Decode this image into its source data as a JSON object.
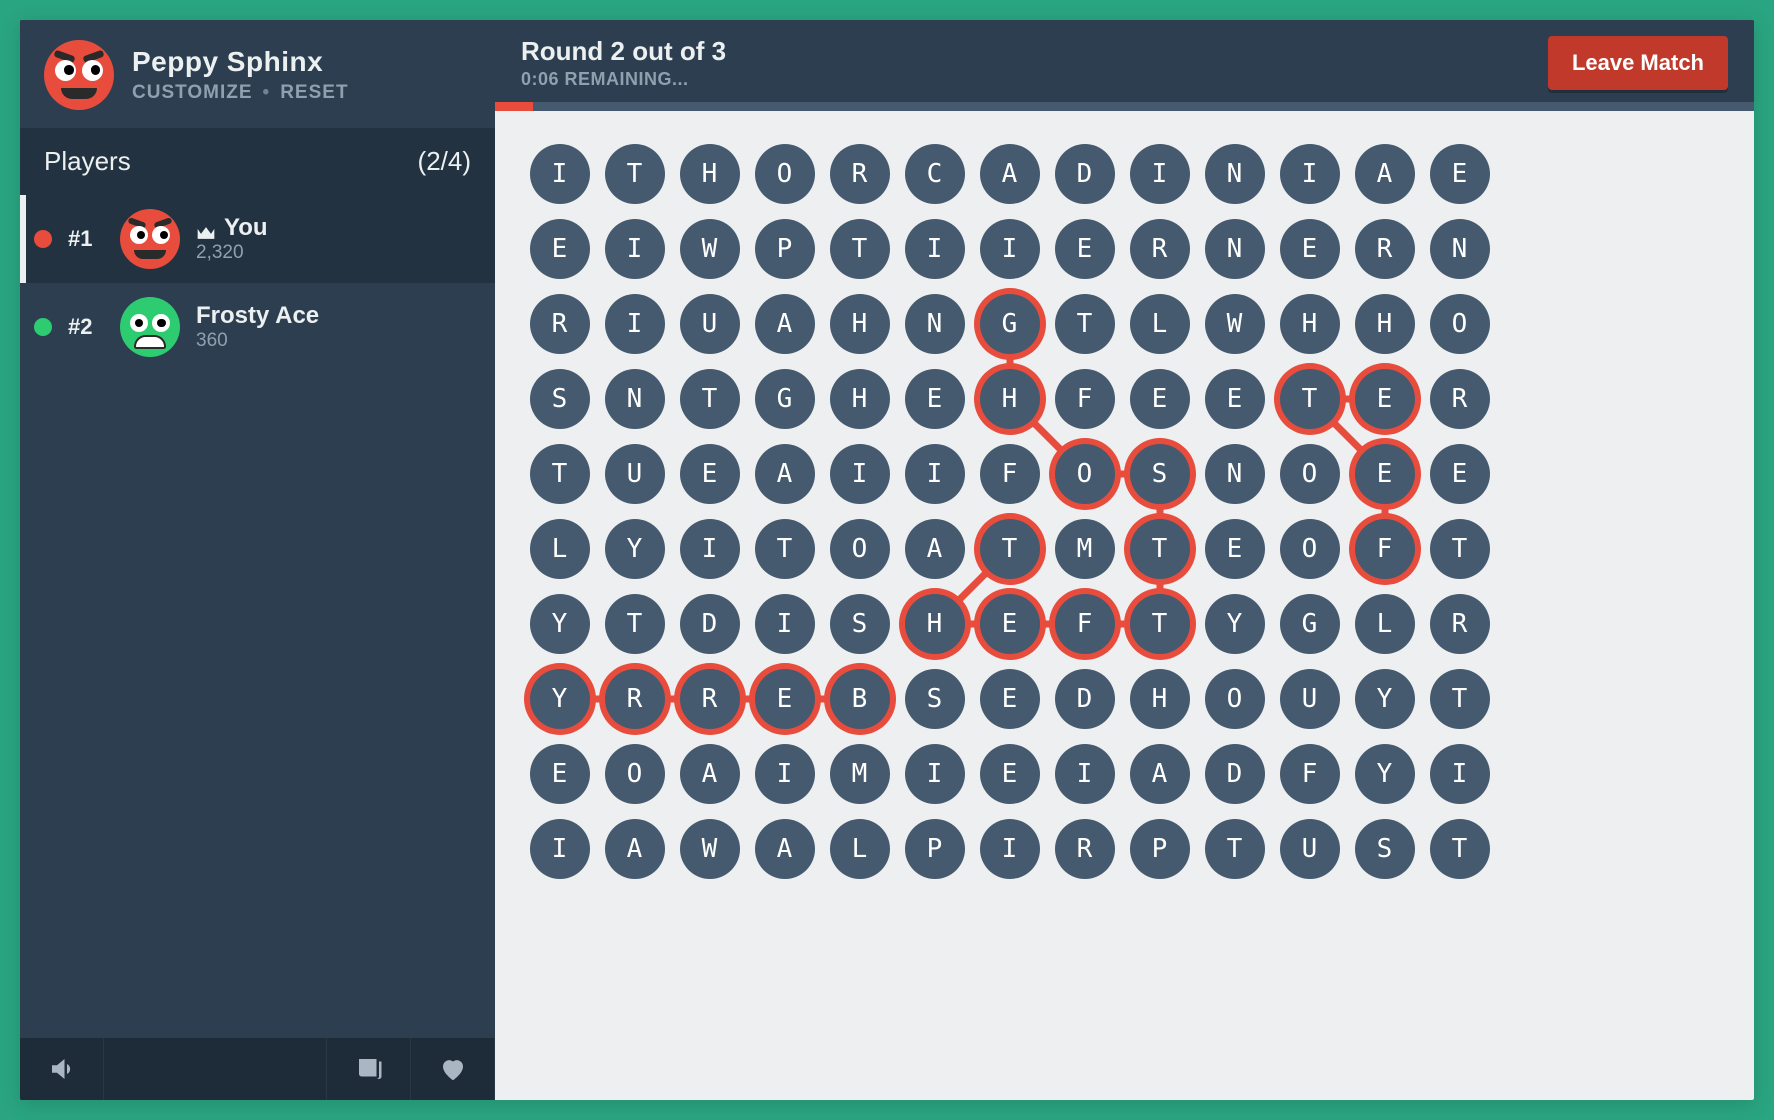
{
  "profile": {
    "name": "Peppy Sphinx",
    "customize_label": "CUSTOMIZE",
    "reset_label": "RESET",
    "avatar_mood": "angry-red"
  },
  "players": {
    "header": "Players",
    "count_label": "(2/4)",
    "list": [
      {
        "rank": "#1",
        "name": "You",
        "score": "2,320",
        "is_you": true,
        "color": "red",
        "avatar_mood": "angry-red"
      },
      {
        "rank": "#2",
        "name": "Frosty Ace",
        "score": "360",
        "is_you": false,
        "color": "green",
        "avatar_mood": "happy-green"
      }
    ]
  },
  "round": {
    "title": "Round 2 out of 3",
    "time": "0:06 REMAINING...",
    "progress_pct": 3
  },
  "leave_label": "Leave Match",
  "board": {
    "cols": 14,
    "rows": 10,
    "letters": [
      [
        "I",
        "T",
        "H",
        "O",
        "R",
        "C",
        "A",
        "D",
        "I",
        "N",
        "I",
        "A",
        "E",
        ""
      ],
      [
        "E",
        "I",
        "W",
        "P",
        "T",
        "I",
        "I",
        "E",
        "R",
        "N",
        "E",
        "R",
        "N",
        ""
      ],
      [
        "R",
        "I",
        "U",
        "A",
        "H",
        "N",
        "G",
        "T",
        "L",
        "W",
        "H",
        "H",
        "O",
        ""
      ],
      [
        "S",
        "N",
        "T",
        "G",
        "H",
        "E",
        "H",
        "F",
        "E",
        "E",
        "T",
        "E",
        "R",
        ""
      ],
      [
        "T",
        "U",
        "E",
        "A",
        "I",
        "I",
        "F",
        "O",
        "S",
        "N",
        "O",
        "E",
        "E",
        ""
      ],
      [
        "L",
        "Y",
        "I",
        "T",
        "O",
        "A",
        "T",
        "M",
        "T",
        "E",
        "O",
        "F",
        "T",
        ""
      ],
      [
        "Y",
        "T",
        "D",
        "I",
        "S",
        "H",
        "E",
        "F",
        "T",
        "Y",
        "G",
        "L",
        "R",
        ""
      ],
      [
        "Y",
        "R",
        "R",
        "E",
        "B",
        "S",
        "E",
        "D",
        "H",
        "O",
        "U",
        "Y",
        "T",
        ""
      ],
      [
        "E",
        "O",
        "A",
        "I",
        "M",
        "I",
        "E",
        "I",
        "A",
        "D",
        "F",
        "Y",
        "I",
        ""
      ],
      [
        "I",
        "A",
        "W",
        "A",
        "L",
        "P",
        "I",
        "R",
        "P",
        "T",
        "U",
        "S",
        "T",
        ""
      ]
    ],
    "paths": [
      [
        [
          2,
          6
        ],
        [
          3,
          6
        ],
        [
          4,
          7
        ],
        [
          4,
          8
        ],
        [
          5,
          8
        ],
        [
          6,
          8
        ],
        [
          6,
          7
        ],
        [
          6,
          6
        ],
        [
          6,
          5
        ],
        [
          5,
          6
        ]
      ],
      [
        [
          3,
          11
        ],
        [
          3,
          10
        ],
        [
          4,
          11
        ],
        [
          5,
          11
        ]
      ],
      [
        [
          7,
          4
        ],
        [
          7,
          3
        ],
        [
          7,
          2
        ],
        [
          7,
          1
        ],
        [
          7,
          0
        ]
      ]
    ]
  },
  "footer_icons": [
    "sound-icon",
    "news-icon",
    "heart-icon"
  ]
}
